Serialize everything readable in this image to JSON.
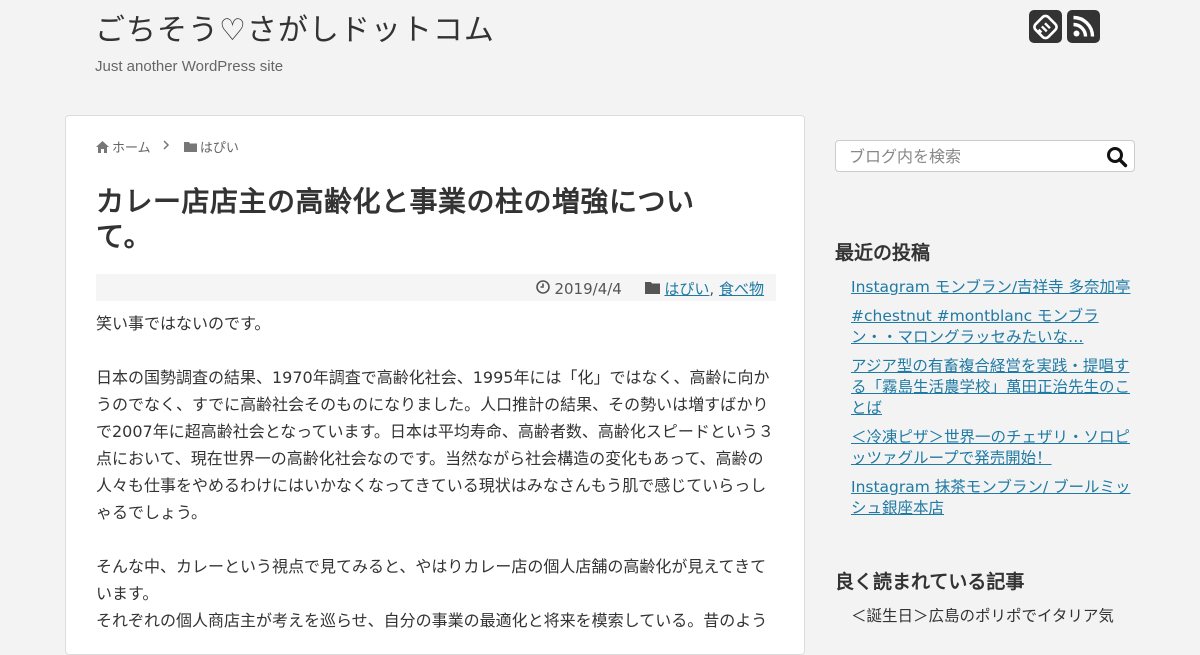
{
  "header": {
    "site_title": "ごちそう♡さがしドットコム",
    "site_description": "Just another WordPress site",
    "icons": [
      "feedly-icon",
      "rss-icon"
    ]
  },
  "breadcrumb": {
    "home_label": "ホーム",
    "category_label": "はぴい"
  },
  "post": {
    "title": "カレー店店主の高齢化と事業の柱の増強について。",
    "date": "2019/4/4",
    "categories": [
      "はぴい",
      "食べ物"
    ],
    "category_separator": ",",
    "paragraphs": [
      "笑い事ではないのです。",
      "日本の国勢調査の結果、1970年調査で高齢化社会、1995年には「化」ではなく、高齢に向かうのでなく、すでに高齢社会そのものになりました。人口推計の結果、その勢いは増すばかりで2007年に超高齢社会となっています。日本は平均寿命、高齢者数、高齢化スピードという３点において、現在世界一の高齢化社会なのです。当然ながら社会構造の変化もあって、高齢の人々も仕事をやめるわけにはいかなくなってきている現状はみなさんもう肌で感じていらっしゃるでしょう。",
      "そんな中、カレーという視点で見てみると、やはりカレー店の個人店舗の高齢化が見えてきています。",
      "それぞれの個人商店主が考えを巡らせ、自分の事業の最適化と将来を模索している。昔のよう"
    ]
  },
  "sidebar": {
    "search_placeholder": "ブログ内を検索",
    "recent_title": "最近の投稿",
    "recent_posts": [
      "Instagram モンブラン/吉祥寺 多奈加亭",
      "#chestnut #montblanc モンブラン・・マロングラッセみたいな…",
      "アジア型の有畜複合経営を実践・提唱する「霧島生活農学校」萬田正治先生のことば",
      "＜冷凍ピザ＞世界一のチェザリ・ソロピッツァグループで発売開始！",
      "Instagram 抹茶モンブラン/ ブールミッシュ銀座本店"
    ],
    "popular_title": "良く読まれている記事",
    "popular_posts": [
      "＜誕生日＞広島のポリポでイタリア気"
    ]
  },
  "colors": {
    "link": "#1f7aa4",
    "background": "#f3f3f3",
    "icon_bg": "#333333"
  }
}
